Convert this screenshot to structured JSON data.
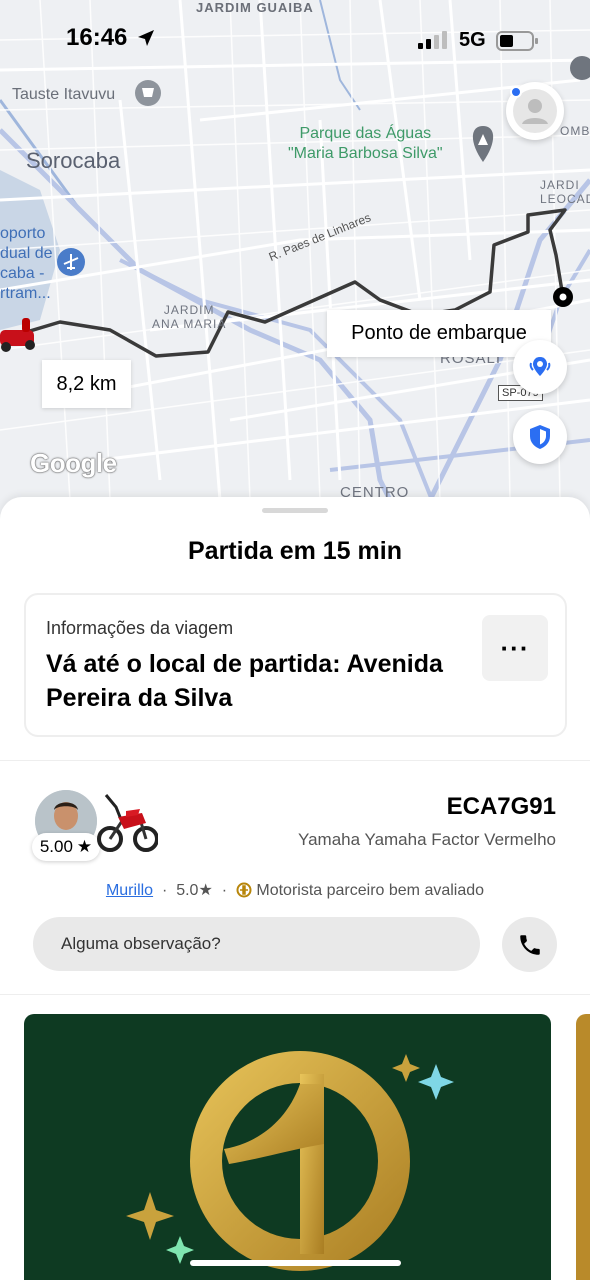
{
  "status_bar": {
    "time": "16:46",
    "network": "5G"
  },
  "map": {
    "labels": {
      "jardim_guaiba": "JARDIM GUAIBA",
      "tauste": "Tauste Itavuvu",
      "sorocaba": "Sorocaba",
      "parque_line1": "Parque das Águas",
      "parque_line2": "\"Maria Barbosa Silva\"",
      "aeroporto_1": "oporto",
      "aeroporto_2": "dual de",
      "aeroporto_3": "caba -",
      "aeroporto_4": "rtram...",
      "rua": "R. Paes de Linhares",
      "jardim_ana_maria_1": "JARDIM",
      "jardim_ana_maria_2": "ANA MARIA",
      "jardim_leocadia_1": "JARDI",
      "jardim_leocadia_2": "LEOCAD",
      "rosalia": "ROSALI",
      "centro": "CENTRO",
      "ombi": "OMBI",
      "sp_shield": "SP-079"
    },
    "distance": "8,2 km",
    "pickup_label": "Ponto de embarque",
    "google_logo": "Google"
  },
  "sheet": {
    "title": "Partida em 15 min",
    "trip": {
      "label": "Informações da viagem",
      "destination": "Vá até o local de partida: Avenida Pereira da Silva",
      "more": "···"
    },
    "driver": {
      "rating": "5.00",
      "plate": "ECA7G91",
      "vehicle": "Yamaha Yamaha Factor Vermelho",
      "name": "Murillo",
      "driver_rating": "5.0★",
      "badge_text": "Motorista parceiro bem avaliado"
    },
    "note": {
      "placeholder": "Alguma observação?"
    }
  },
  "colors": {
    "route": "#3a3a3a",
    "accent_blue": "#2b6ef2",
    "promo_green": "#0e3a22",
    "promo_gold": "#c9a23d"
  }
}
